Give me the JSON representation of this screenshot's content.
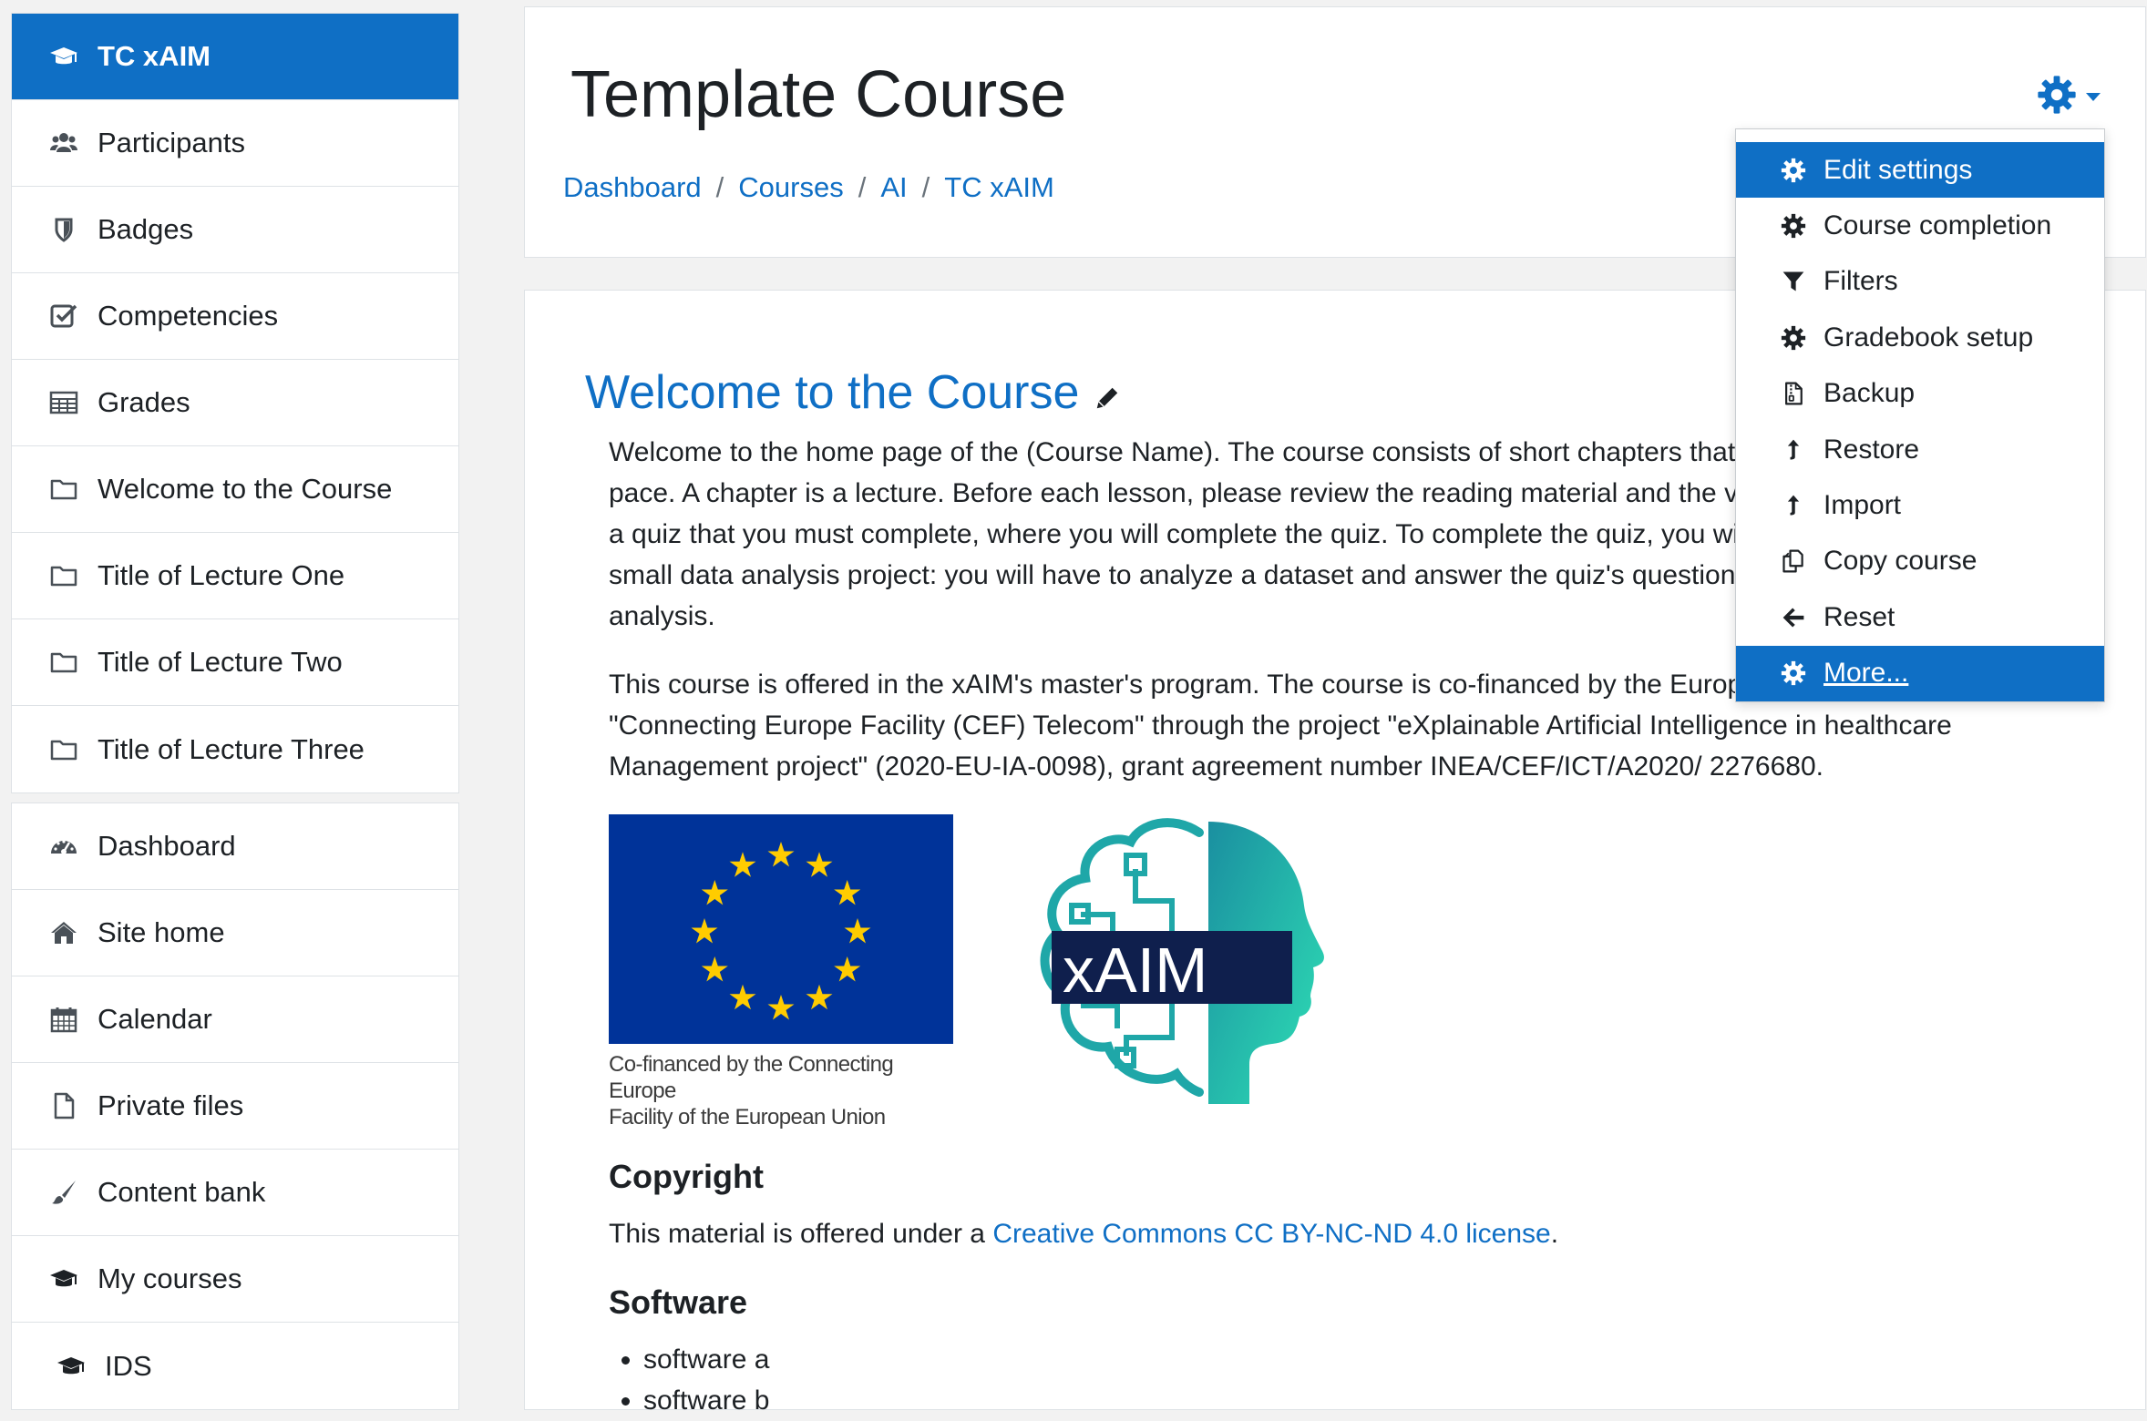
{
  "sidebar": {
    "course_items": [
      {
        "label": "TC xAIM",
        "icon": "graduation-cap-icon",
        "active": true
      },
      {
        "label": "Participants",
        "icon": "users-icon"
      },
      {
        "label": "Badges",
        "icon": "shield-icon"
      },
      {
        "label": "Competencies",
        "icon": "check-square-icon"
      },
      {
        "label": "Grades",
        "icon": "table-icon"
      },
      {
        "label": "Welcome to the Course",
        "icon": "folder-icon"
      },
      {
        "label": "Title of Lecture One",
        "icon": "folder-icon"
      },
      {
        "label": "Title of Lecture Two",
        "icon": "folder-icon"
      },
      {
        "label": "Title of Lecture Three",
        "icon": "folder-icon"
      }
    ],
    "site_items": [
      {
        "label": "Dashboard",
        "icon": "dashboard-icon"
      },
      {
        "label": "Site home",
        "icon": "home-icon"
      },
      {
        "label": "Calendar",
        "icon": "calendar-icon"
      },
      {
        "label": "Private files",
        "icon": "file-icon"
      },
      {
        "label": "Content bank",
        "icon": "paintbrush-icon"
      },
      {
        "label": "My courses",
        "icon": "graduation-cap-icon"
      },
      {
        "label": "IDS",
        "icon": "graduation-cap-icon"
      }
    ]
  },
  "header": {
    "title": "Template Course",
    "breadcrumb": [
      "Dashboard",
      "Courses",
      "AI",
      "TC xAIM"
    ],
    "breadcrumb_separator": "/"
  },
  "dropdown": {
    "items": [
      {
        "label": "Edit settings",
        "icon": "gear-icon"
      },
      {
        "label": "Course completion",
        "icon": "gear-icon"
      },
      {
        "label": "Filters",
        "icon": "filter-icon"
      },
      {
        "label": "Gradebook setup",
        "icon": "gear-icon"
      },
      {
        "label": "Backup",
        "icon": "file-archive-icon"
      },
      {
        "label": "Restore",
        "icon": "level-up-icon"
      },
      {
        "label": "Import",
        "icon": "level-up-icon"
      },
      {
        "label": "Copy course",
        "icon": "copy-icon"
      },
      {
        "label": "Reset",
        "icon": "arrow-left-icon"
      },
      {
        "label": "More...",
        "icon": "gear-icon"
      }
    ]
  },
  "main": {
    "section_title": "Welcome to the Course",
    "paragraph1": "Welcome to the home page of the (Course Name). The course consists of short chapters that you can take at your own pace. A chapter is a lecture. Before each lesson, please review the reading material and the videos. Each lesson ends with a quiz that you must complete, where you will complete the quiz. To complete the quiz, you will most often need to do a small data analysis project: you will have to analyze a dataset and answer the quiz's questions with the results of your analysis.",
    "paragraph2": "This course is offered in the xAIM's master's program. The course is co-financed by the European Union's instrument \"Connecting Europe Facility (CEF) Telecom\" through the project \"eXplainable Artificial Intelligence in healthcare Management project\" (2020-EU-IA-0098), grant agreement number INEA/CEF/ICT/A2020/ 2276680.",
    "eu_caption_line1": "Co-financed by the Connecting Europe",
    "eu_caption_line2": "Facility of the European Union",
    "xaim_logo_text": "xAIM",
    "copyright_heading": "Copyright",
    "copyright_prefix": "This material is offered under a ",
    "copyright_link": "Creative Commons CC BY-NC-ND 4.0 license",
    "copyright_suffix": ".",
    "software_heading": "Software",
    "software_items": [
      "software a",
      "software b"
    ]
  },
  "colors": {
    "accent": "#0f6fc5",
    "eu_blue": "#003399",
    "eu_star": "#ffcc00",
    "xaim_teal": "#1fb5a8",
    "xaim_navy": "#0f1f4d"
  }
}
